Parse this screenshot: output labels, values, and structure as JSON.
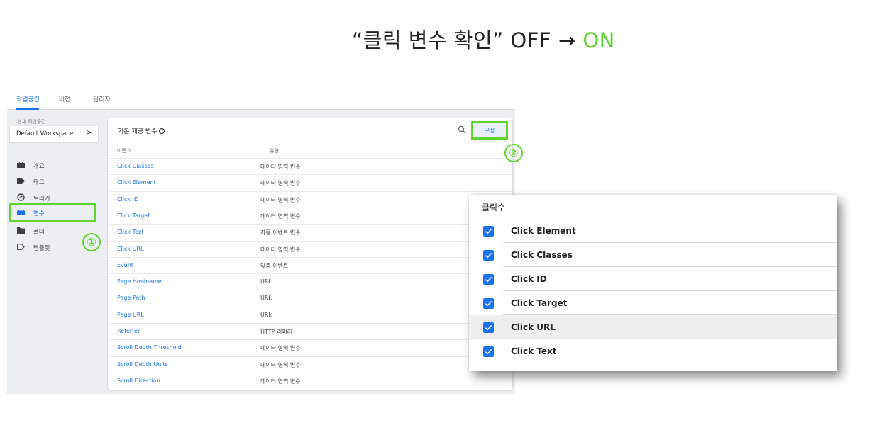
{
  "heading": {
    "prefix": "“클릭 변수 확인” OFF → ",
    "highlight": "ON"
  },
  "colors": {
    "accent": "#1a73e8",
    "highlight": "#5fd42f"
  },
  "topnav": {
    "tabs": [
      "작업공간",
      "버전",
      "관리자"
    ],
    "active": 0
  },
  "workspace": {
    "label": "현재 작업공간",
    "name": "Default Workspace",
    "chevron": ">"
  },
  "sidebar": {
    "items": [
      {
        "label": "개요",
        "icon": "briefcase-icon"
      },
      {
        "label": "태그",
        "icon": "tag-icon"
      },
      {
        "label": "트리거",
        "icon": "trigger-icon"
      },
      {
        "label": "변수",
        "icon": "variables-icon"
      },
      {
        "label": "폴더",
        "icon": "folder-icon"
      },
      {
        "label": "템플릿",
        "icon": "template-icon"
      }
    ],
    "active": 3
  },
  "markers": {
    "one": "①",
    "two": "②"
  },
  "panel": {
    "title": "기본 제공 변수",
    "help": "?",
    "configure": "구성",
    "col_name": "이름 ↑",
    "col_type": "유형",
    "rows": [
      {
        "name": "Click Classes",
        "type": "데이터 영역 변수"
      },
      {
        "name": "Click Element",
        "type": "데이터 영역 변수"
      },
      {
        "name": "Click ID",
        "type": "데이터 영역 변수"
      },
      {
        "name": "Click Target",
        "type": "데이터 영역 변수"
      },
      {
        "name": "Click Text",
        "type": "자동 이벤트 변수"
      },
      {
        "name": "Click URL",
        "type": "데이터 영역 변수"
      },
      {
        "name": "Event",
        "type": "맞춤 이벤트"
      },
      {
        "name": "Page Hostname",
        "type": "URL"
      },
      {
        "name": "Page Path",
        "type": "URL"
      },
      {
        "name": "Page URL",
        "type": "URL"
      },
      {
        "name": "Referrer",
        "type": "HTTP 리퍼러"
      },
      {
        "name": "Scroll Depth Threshold",
        "type": "데이터 영역 변수"
      },
      {
        "name": "Scroll Depth Units",
        "type": "데이터 영역 변수"
      },
      {
        "name": "Scroll Direction",
        "type": "데이터 영역 변수"
      }
    ]
  },
  "dialog": {
    "title": "클릭수",
    "items": [
      {
        "label": "Click Element",
        "checked": true
      },
      {
        "label": "Click Classes",
        "checked": true
      },
      {
        "label": "Click ID",
        "checked": true
      },
      {
        "label": "Click Target",
        "checked": true
      },
      {
        "label": "Click URL",
        "checked": true
      },
      {
        "label": "Click Text",
        "checked": true
      }
    ],
    "hovered": 4
  }
}
